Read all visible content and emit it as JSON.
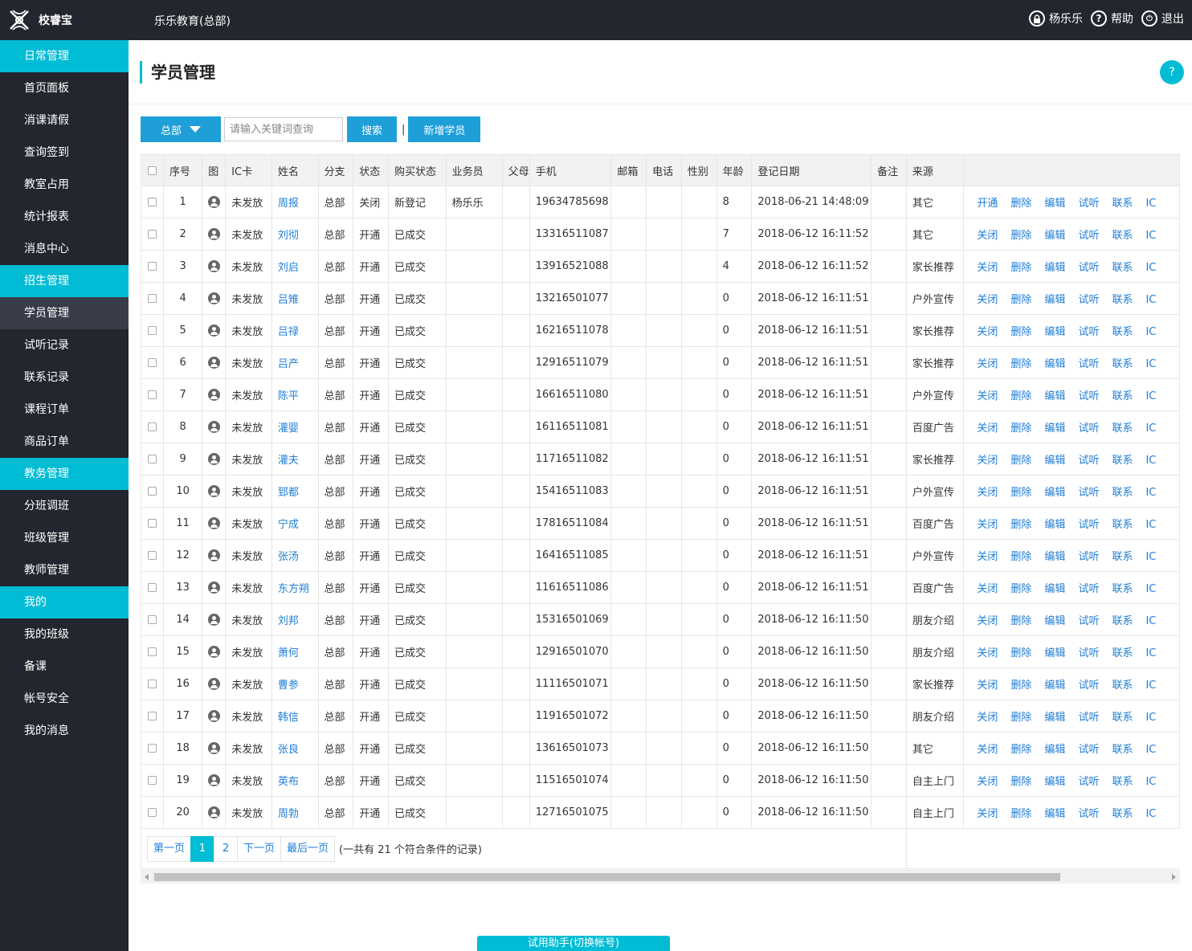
{
  "app": {
    "logo_text": "校睿宝",
    "org": "乐乐教育(总部)"
  },
  "topbar": {
    "user": "杨乐乐",
    "help": "帮助",
    "logout": "退出"
  },
  "sidebar": {
    "items": [
      {
        "label": "日常管理",
        "type": "group"
      },
      {
        "label": "首页面板",
        "type": "item"
      },
      {
        "label": "消课请假",
        "type": "item"
      },
      {
        "label": "查询签到",
        "type": "item"
      },
      {
        "label": "教室占用",
        "type": "item"
      },
      {
        "label": "统计报表",
        "type": "item"
      },
      {
        "label": "消息中心",
        "type": "item"
      },
      {
        "label": "招生管理",
        "type": "group"
      },
      {
        "label": "学员管理",
        "type": "active"
      },
      {
        "label": "试听记录",
        "type": "item"
      },
      {
        "label": "联系记录",
        "type": "item"
      },
      {
        "label": "课程订单",
        "type": "item"
      },
      {
        "label": "商品订单",
        "type": "item"
      },
      {
        "label": "教务管理",
        "type": "group"
      },
      {
        "label": "分班调班",
        "type": "item"
      },
      {
        "label": "班级管理",
        "type": "item"
      },
      {
        "label": "教师管理",
        "type": "item"
      },
      {
        "label": "我的",
        "type": "group"
      },
      {
        "label": "我的班级",
        "type": "item"
      },
      {
        "label": "备课",
        "type": "item"
      },
      {
        "label": "帐号安全",
        "type": "item"
      },
      {
        "label": "我的消息",
        "type": "item"
      }
    ]
  },
  "page": {
    "title": "学员管理",
    "help_icon": "?"
  },
  "toolbar": {
    "branch": "总部",
    "search_placeholder": "请输入关键词查询",
    "search_label": "搜索",
    "separator": "|",
    "add_label": "新增学员"
  },
  "table": {
    "headers": [
      "序号",
      "图",
      "IC卡",
      "姓名",
      "分支",
      "状态",
      "购买状态",
      "业务员",
      "父母",
      "手机",
      "邮箱",
      "电话",
      "性别",
      "年龄",
      "登记日期",
      "备注",
      "来源"
    ],
    "ops": [
      "删除",
      "编辑",
      "试听",
      "联系",
      "IC"
    ],
    "rows": [
      {
        "no": "1",
        "ic": "未发放",
        "name": "周报",
        "branch": "总部",
        "status": "关闭",
        "buy": "新登记",
        "sales": "杨乐乐",
        "phone": "19634785698",
        "age": "8",
        "date": "2018-06-21 14:48:09",
        "source": "其它",
        "toggle": "开通"
      },
      {
        "no": "2",
        "ic": "未发放",
        "name": "刘彻",
        "branch": "总部",
        "status": "开通",
        "buy": "已成交",
        "sales": "",
        "phone": "13316511087",
        "age": "7",
        "date": "2018-06-12 16:11:52",
        "source": "其它",
        "toggle": "关闭"
      },
      {
        "no": "3",
        "ic": "未发放",
        "name": "刘启",
        "branch": "总部",
        "status": "开通",
        "buy": "已成交",
        "sales": "",
        "phone": "13916521088",
        "age": "4",
        "date": "2018-06-12 16:11:52",
        "source": "家长推荐",
        "toggle": "关闭"
      },
      {
        "no": "4",
        "ic": "未发放",
        "name": "吕雉",
        "branch": "总部",
        "status": "开通",
        "buy": "已成交",
        "sales": "",
        "phone": "13216501077",
        "age": "0",
        "date": "2018-06-12 16:11:51",
        "source": "户外宣传",
        "toggle": "关闭"
      },
      {
        "no": "5",
        "ic": "未发放",
        "name": "吕禄",
        "branch": "总部",
        "status": "开通",
        "buy": "已成交",
        "sales": "",
        "phone": "16216511078",
        "age": "0",
        "date": "2018-06-12 16:11:51",
        "source": "家长推荐",
        "toggle": "关闭"
      },
      {
        "no": "6",
        "ic": "未发放",
        "name": "吕产",
        "branch": "总部",
        "status": "开通",
        "buy": "已成交",
        "sales": "",
        "phone": "12916511079",
        "age": "0",
        "date": "2018-06-12 16:11:51",
        "source": "家长推荐",
        "toggle": "关闭"
      },
      {
        "no": "7",
        "ic": "未发放",
        "name": "陈平",
        "branch": "总部",
        "status": "开通",
        "buy": "已成交",
        "sales": "",
        "phone": "16616511080",
        "age": "0",
        "date": "2018-06-12 16:11:51",
        "source": "户外宣传",
        "toggle": "关闭"
      },
      {
        "no": "8",
        "ic": "未发放",
        "name": "灌婴",
        "branch": "总部",
        "status": "开通",
        "buy": "已成交",
        "sales": "",
        "phone": "16116511081",
        "age": "0",
        "date": "2018-06-12 16:11:51",
        "source": "百度广告",
        "toggle": "关闭"
      },
      {
        "no": "9",
        "ic": "未发放",
        "name": "灌夫",
        "branch": "总部",
        "status": "开通",
        "buy": "已成交",
        "sales": "",
        "phone": "11716511082",
        "age": "0",
        "date": "2018-06-12 16:11:51",
        "source": "家长推荐",
        "toggle": "关闭"
      },
      {
        "no": "10",
        "ic": "未发放",
        "name": "郅都",
        "branch": "总部",
        "status": "开通",
        "buy": "已成交",
        "sales": "",
        "phone": "15416511083",
        "age": "0",
        "date": "2018-06-12 16:11:51",
        "source": "户外宣传",
        "toggle": "关闭"
      },
      {
        "no": "11",
        "ic": "未发放",
        "name": "宁成",
        "branch": "总部",
        "status": "开通",
        "buy": "已成交",
        "sales": "",
        "phone": "17816511084",
        "age": "0",
        "date": "2018-06-12 16:11:51",
        "source": "百度广告",
        "toggle": "关闭"
      },
      {
        "no": "12",
        "ic": "未发放",
        "name": "张汤",
        "branch": "总部",
        "status": "开通",
        "buy": "已成交",
        "sales": "",
        "phone": "16416511085",
        "age": "0",
        "date": "2018-06-12 16:11:51",
        "source": "户外宣传",
        "toggle": "关闭"
      },
      {
        "no": "13",
        "ic": "未发放",
        "name": "东方朔",
        "branch": "总部",
        "status": "开通",
        "buy": "已成交",
        "sales": "",
        "phone": "11616511086",
        "age": "0",
        "date": "2018-06-12 16:11:51",
        "source": "百度广告",
        "toggle": "关闭"
      },
      {
        "no": "14",
        "ic": "未发放",
        "name": "刘邦",
        "branch": "总部",
        "status": "开通",
        "buy": "已成交",
        "sales": "",
        "phone": "15316501069",
        "age": "0",
        "date": "2018-06-12 16:11:50",
        "source": "朋友介绍",
        "toggle": "关闭"
      },
      {
        "no": "15",
        "ic": "未发放",
        "name": "萧何",
        "branch": "总部",
        "status": "开通",
        "buy": "已成交",
        "sales": "",
        "phone": "12916501070",
        "age": "0",
        "date": "2018-06-12 16:11:50",
        "source": "朋友介绍",
        "toggle": "关闭"
      },
      {
        "no": "16",
        "ic": "未发放",
        "name": "曹参",
        "branch": "总部",
        "status": "开通",
        "buy": "已成交",
        "sales": "",
        "phone": "11116501071",
        "age": "0",
        "date": "2018-06-12 16:11:50",
        "source": "家长推荐",
        "toggle": "关闭"
      },
      {
        "no": "17",
        "ic": "未发放",
        "name": "韩信",
        "branch": "总部",
        "status": "开通",
        "buy": "已成交",
        "sales": "",
        "phone": "11916501072",
        "age": "0",
        "date": "2018-06-12 16:11:50",
        "source": "朋友介绍",
        "toggle": "关闭"
      },
      {
        "no": "18",
        "ic": "未发放",
        "name": "张良",
        "branch": "总部",
        "status": "开通",
        "buy": "已成交",
        "sales": "",
        "phone": "13616501073",
        "age": "0",
        "date": "2018-06-12 16:11:50",
        "source": "其它",
        "toggle": "关闭"
      },
      {
        "no": "19",
        "ic": "未发放",
        "name": "英布",
        "branch": "总部",
        "status": "开通",
        "buy": "已成交",
        "sales": "",
        "phone": "11516501074",
        "age": "0",
        "date": "2018-06-12 16:11:50",
        "source": "自主上门",
        "toggle": "关闭"
      },
      {
        "no": "20",
        "ic": "未发放",
        "name": "周勃",
        "branch": "总部",
        "status": "开通",
        "buy": "已成交",
        "sales": "",
        "phone": "12716501075",
        "age": "0",
        "date": "2018-06-12 16:11:50",
        "source": "自主上门",
        "toggle": "关闭"
      }
    ]
  },
  "pager": {
    "first": "第一页",
    "pages": [
      "1",
      "2"
    ],
    "current": "1",
    "next": "下一页",
    "last": "最后一页",
    "info": "(一共有 21 个符合条件的记录)"
  },
  "assist": {
    "label": "试用助手(切换帐号)"
  },
  "colors": {
    "accent": "#00bcd4",
    "button": "#1e9fd8",
    "sidebar_bg": "#23262e",
    "active_bg": "#393d49",
    "link": "#1e7dd8"
  }
}
